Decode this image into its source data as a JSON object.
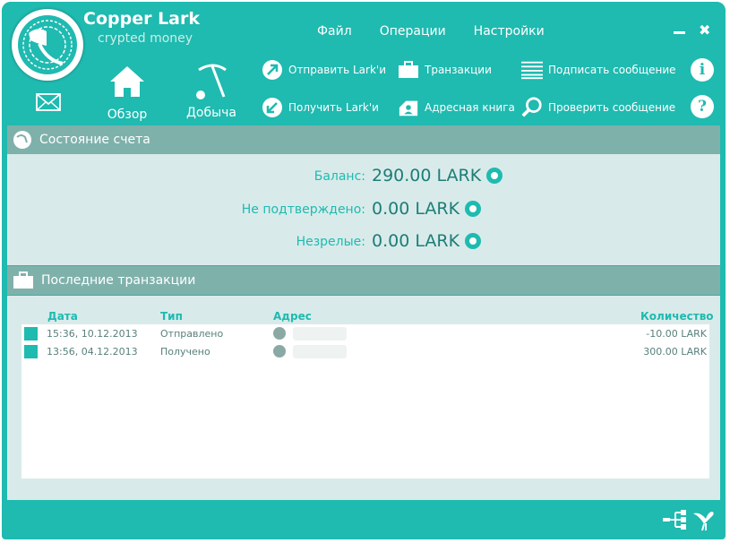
{
  "app": {
    "title": "Copper Lark",
    "subtitle": "crypted money"
  },
  "menu": [
    "Файл",
    "Операции",
    "Настройки"
  ],
  "window_controls": {
    "minimize": "—",
    "close": "✖"
  },
  "nav": {
    "overview": "Обзор",
    "mining": "Добыча"
  },
  "toolbar": {
    "send": "Отправить Lark'и",
    "receive": "Получить Lark'и",
    "transactions": "Транзакции",
    "address_book": "Адресная книга",
    "sign_message": "Подписать сообщение",
    "verify_message": "Проверить сообщение"
  },
  "help": {
    "info": "i",
    "question": "?"
  },
  "account": {
    "title": "Состояние счета",
    "balance_label": "Баланс:",
    "balance_value": "290.00 LARK",
    "unconfirmed_label": "Не подтверждено:",
    "unconfirmed_value": "0.00 LARK",
    "immature_label": "Незрелые:",
    "immature_value": "0.00 LARK"
  },
  "recent": {
    "title": "Последние транзакции",
    "columns": {
      "date": "Дата",
      "type": "Тип",
      "address": "Адрес",
      "amount": "Количество"
    },
    "rows": [
      {
        "date": "15:36, 10.12.2013",
        "type": "Отправлено",
        "amount": "-10.00 LARK"
      },
      {
        "date": "13:56, 04.12.2013",
        "type": "Получено",
        "amount": "300.00 LARK"
      }
    ]
  },
  "colors": {
    "accent": "#1fbab0",
    "section": "#7fb1ab",
    "panel": "#d8ebea"
  }
}
